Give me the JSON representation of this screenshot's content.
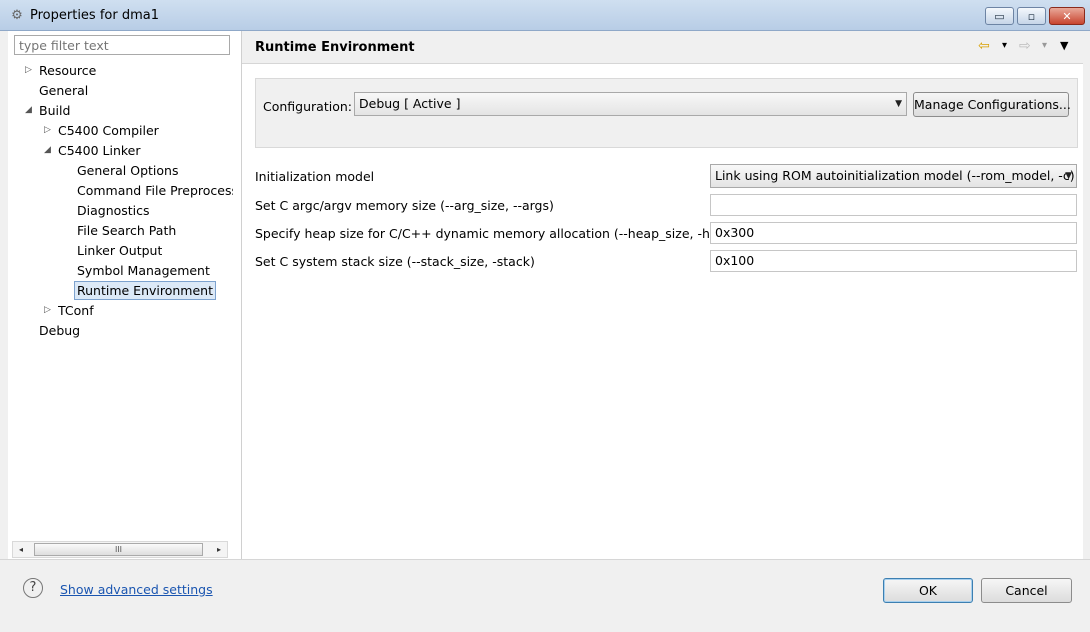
{
  "window": {
    "title": "Properties for dma1",
    "icon": "gear-icon",
    "buttons": {
      "min": "▭",
      "max": "▫",
      "close": "✕"
    }
  },
  "filter": {
    "placeholder": "type filter text"
  },
  "tree": {
    "items": [
      {
        "label": "Resource",
        "arrow": "▷"
      },
      {
        "label": "General",
        "arrow": ""
      },
      {
        "label": "Build",
        "arrow": "◢"
      },
      {
        "label": "C5400 Compiler",
        "arrow": "▷"
      },
      {
        "label": "C5400 Linker",
        "arrow": "◢"
      },
      {
        "label": "General Options",
        "arrow": ""
      },
      {
        "label": "Command File Preprocessi",
        "arrow": ""
      },
      {
        "label": "Diagnostics",
        "arrow": ""
      },
      {
        "label": "File Search Path",
        "arrow": ""
      },
      {
        "label": "Linker Output",
        "arrow": ""
      },
      {
        "label": "Symbol Management",
        "arrow": ""
      },
      {
        "label": "Runtime Environment",
        "arrow": ""
      },
      {
        "label": "TConf",
        "arrow": "▷"
      },
      {
        "label": "Debug",
        "arrow": ""
      }
    ],
    "scroll": {
      "left": "◂",
      "right": "▸",
      "thumb": "III"
    }
  },
  "page": {
    "title": "Runtime Environment",
    "nav": {
      "back": "⇦",
      "forward": "⇨",
      "dropdown": "▾",
      "menu": "▼"
    }
  },
  "configuration": {
    "label": "Configuration:",
    "value": "Debug  [ Active ]",
    "manage_label": "Manage Configurations..."
  },
  "settings": {
    "init_model": {
      "label": "Initialization model",
      "value": "Link using ROM autoinitialization model (--rom_model, -c)"
    },
    "arg_size": {
      "label": "Set C argc/argv memory size (--arg_size, --args)",
      "value": ""
    },
    "heap_size": {
      "label": "Specify heap size for C/C++ dynamic memory allocation (--heap_size, -heap)",
      "value": "0x300"
    },
    "stack_size": {
      "label": "Set C system stack size (--stack_size, -stack)",
      "value": "0x100"
    }
  },
  "footer": {
    "help_icon": "?",
    "advanced_link": "Show advanced settings",
    "ok_label": "OK",
    "cancel_label": "Cancel"
  }
}
